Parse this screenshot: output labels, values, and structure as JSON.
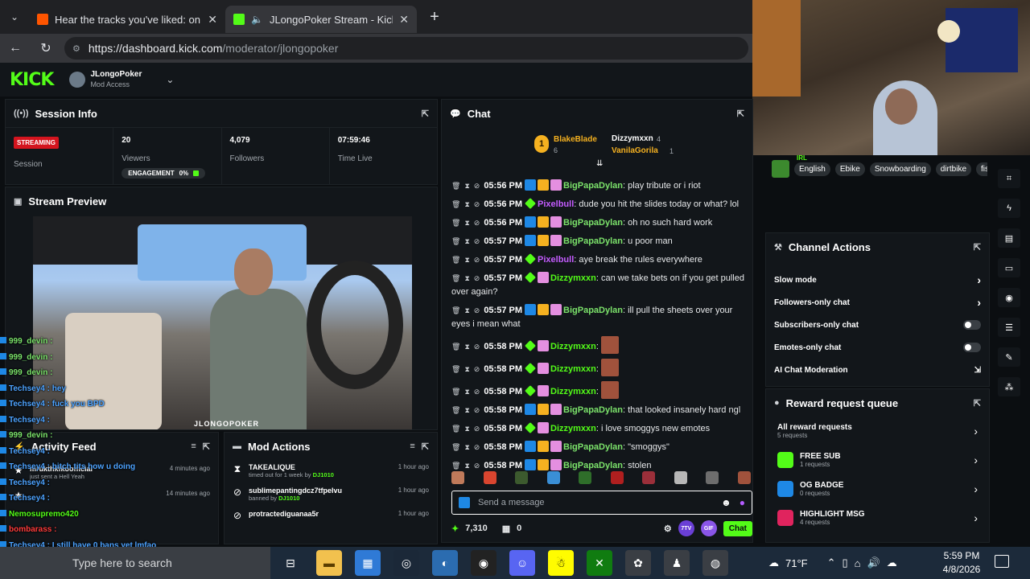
{
  "browser": {
    "tabs": [
      {
        "title": "Hear the tracks you've liked: on So",
        "fav_color": "#ff5500"
      },
      {
        "title": "JLongoPoker Stream - Kick Da",
        "fav_color": "#53fc18"
      }
    ],
    "url_host": "https://dashboard.kick.com",
    "url_path": "/moderator/jlongopoker"
  },
  "kick": {
    "logo": "KICK",
    "channel_name": "JLongoPoker",
    "channel_role": "Mod Access"
  },
  "session": {
    "title": "Session Info",
    "status": "STREAMING",
    "status_label": "Session",
    "viewers": "20",
    "viewers_label": "Viewers",
    "engagement_label": "ENGAGEMENT",
    "engagement_value": "0%",
    "followers": "4,079",
    "followers_label": "Followers",
    "time_live": "07:59:46",
    "time_live_label": "Time Live"
  },
  "preview": {
    "title": "Stream Preview",
    "watermark": "JLONGOPOKER"
  },
  "chat": {
    "title": "Chat",
    "gifters": [
      {
        "name": "BlakeBlade",
        "count": "6",
        "color": "#f5b120"
      },
      {
        "name": "Dizzymxxn",
        "count": "4",
        "color": "#ffffff"
      },
      {
        "name": "VanilaGorila",
        "count": "1",
        "color": "#f5b120"
      }
    ],
    "messages": [
      {
        "time": "05:56 PM",
        "user": "BigPapaDylan",
        "color": "#7ce36b",
        "text": "play tribute or i riot"
      },
      {
        "time": "05:56 PM",
        "user": "Pixelbull",
        "color": "#c45cff",
        "text": "dude you hit the slides today or what? lol"
      },
      {
        "time": "05:56 PM",
        "user": "BigPapaDylan",
        "color": "#7ce36b",
        "text": "oh no such hard work"
      },
      {
        "time": "05:57 PM",
        "user": "BigPapaDylan",
        "color": "#7ce36b",
        "text": "u poor man"
      },
      {
        "time": "05:57 PM",
        "user": "Pixelbull",
        "color": "#c45cff",
        "text": "aye break the rules everywhere"
      },
      {
        "time": "05:57 PM",
        "user": "Dizzymxxn",
        "color": "#53fc18",
        "text": "can we take bets on if you get pulled over again?"
      },
      {
        "time": "05:57 PM",
        "user": "BigPapaDylan",
        "color": "#7ce36b",
        "text": "ill pull the sheets over your eyes i mean what"
      },
      {
        "time": "05:58 PM",
        "user": "Dizzymxxn",
        "color": "#53fc18",
        "text": ""
      },
      {
        "time": "05:58 PM",
        "user": "Dizzymxxn",
        "color": "#53fc18",
        "text": ""
      },
      {
        "time": "05:58 PM",
        "user": "Dizzymxxn",
        "color": "#53fc18",
        "text": ""
      },
      {
        "time": "05:58 PM",
        "user": "BigPapaDylan",
        "color": "#7ce36b",
        "text": "that looked insanely hard ngl"
      },
      {
        "time": "05:58 PM",
        "user": "Dizzymxxn",
        "color": "#53fc18",
        "text": "i love smoggys new emotes"
      },
      {
        "time": "05:58 PM",
        "user": "BigPapaDylan",
        "color": "#7ce36b",
        "text": "\"smoggys\""
      },
      {
        "time": "05:58 PM",
        "user": "BigPapaDylan",
        "color": "#7ce36b",
        "text": "stolen"
      }
    ],
    "input_placeholder": "Send a message",
    "points": "7,310",
    "gifts": "0",
    "btn_7tv": "7TV",
    "btn_gif": "GIF",
    "send_label": "Chat"
  },
  "tags": [
    "English",
    "Ebike",
    "Snowboarding",
    "dirtbike",
    "fis"
  ],
  "tags_category": "IRL",
  "channel_actions": {
    "title": "Channel Actions",
    "rows": [
      "Slow mode",
      "Followers-only chat",
      "Subscribers-only chat",
      "Emotes-only chat",
      "AI Chat Moderation"
    ]
  },
  "reward_queue": {
    "title": "Reward request queue",
    "items": [
      {
        "name": "All reward requests",
        "sub": "5 requests",
        "color": ""
      },
      {
        "name": "FREE SUB",
        "sub": "1 requests",
        "color": "#53fc18"
      },
      {
        "name": "OG BADGE",
        "sub": "0 requests",
        "color": "#1e88e5"
      },
      {
        "name": "HIGHLIGHT MSG",
        "sub": "4 requests",
        "color": "#e0245e"
      }
    ]
  },
  "activity": {
    "title": "Activity Feed",
    "items": [
      {
        "name": "mrukthkfkoofficial",
        "sub": "just sent a Hell Yeah",
        "time": "4 minutes ago"
      },
      {
        "name": "",
        "sub": "",
        "time": "14 minutes ago"
      }
    ]
  },
  "mod_actions": {
    "title": "Mod Actions",
    "items": [
      {
        "name": "TAKEALIQUE",
        "sub_pre": "timed out for 1 week by",
        "by": "DJ1010",
        "time": "1 hour ago"
      },
      {
        "name": "sublimepantingdcz7tfpelvu",
        "sub_pre": "banned by",
        "by": "DJ1010",
        "time": "1 hour ago"
      },
      {
        "name": "protractediguanaa5r",
        "sub_pre": "",
        "by": "",
        "time": "1 hour ago"
      }
    ]
  },
  "overlay_chat": [
    "999_devin :",
    "999_devin :",
    "999_devin :",
    "Techsey4 : hey",
    "Techsey4 : fuck you BPD",
    "Techsey4 :",
    "999_devin :",
    "Techsey4 :",
    "Techsey4 : bitch tits how u doing",
    "Techsey4 :",
    "Techsey4 :",
    "Nemosupremo420",
    "bombarass :",
    "Techsey4 : I still have 0 bans yet lmfao",
    "bombarass :"
  ],
  "taskbar": {
    "search_placeholder": "Type here to search",
    "temp": "71°F",
    "time": "5:59 PM",
    "date": "4/8/2026"
  }
}
